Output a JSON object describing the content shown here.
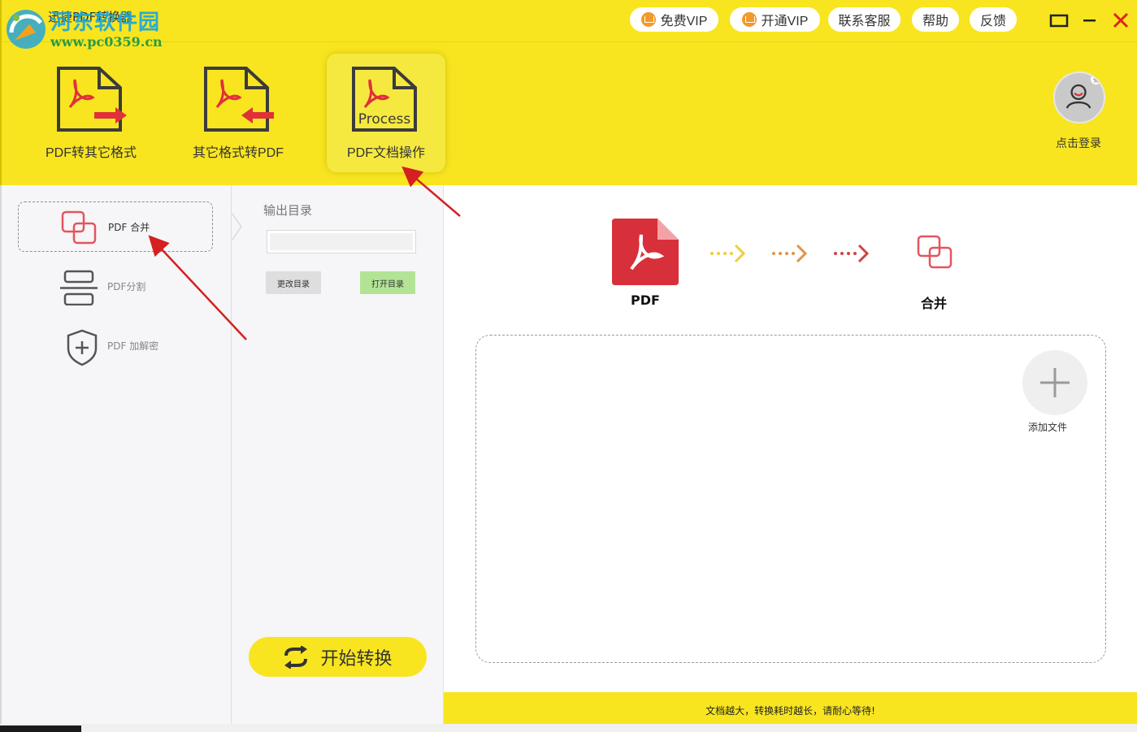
{
  "window": {
    "title": "迅捷PDF转换器",
    "watermark_site": "河东软件园",
    "watermark_url": "www.pc0359.cn"
  },
  "top_buttons": {
    "free_vip": "免费VIP",
    "open_vip": "开通VIP",
    "contact": "联系客服",
    "help": "帮助",
    "feedback": "反馈"
  },
  "tools": [
    {
      "label": "PDF转其它格式"
    },
    {
      "label": "其它格式转PDF"
    },
    {
      "label": "PDF文档操作",
      "icon_text": "Process"
    }
  ],
  "user": {
    "login_label": "点击登录"
  },
  "nav": [
    {
      "label": "PDF 合并"
    },
    {
      "label": "PDF分割"
    },
    {
      "label": "PDF 加解密"
    }
  ],
  "output": {
    "label": "输出目录",
    "path_value": "",
    "change_label": "更改目录",
    "open_label": "打开目录"
  },
  "start_button": {
    "label": "开始转换"
  },
  "flow": {
    "source_label": "PDF",
    "target_label": "合并"
  },
  "add_file": {
    "label": "添加文件"
  },
  "status": {
    "message": "文档越大，转换耗时越长，请耐心等待!"
  },
  "colors": {
    "brand_yellow": "#f8e520",
    "pdf_red": "#d8303a",
    "merge_pink": "#e2555f",
    "open_green": "#b3e496",
    "change_gray": "#dedede"
  }
}
